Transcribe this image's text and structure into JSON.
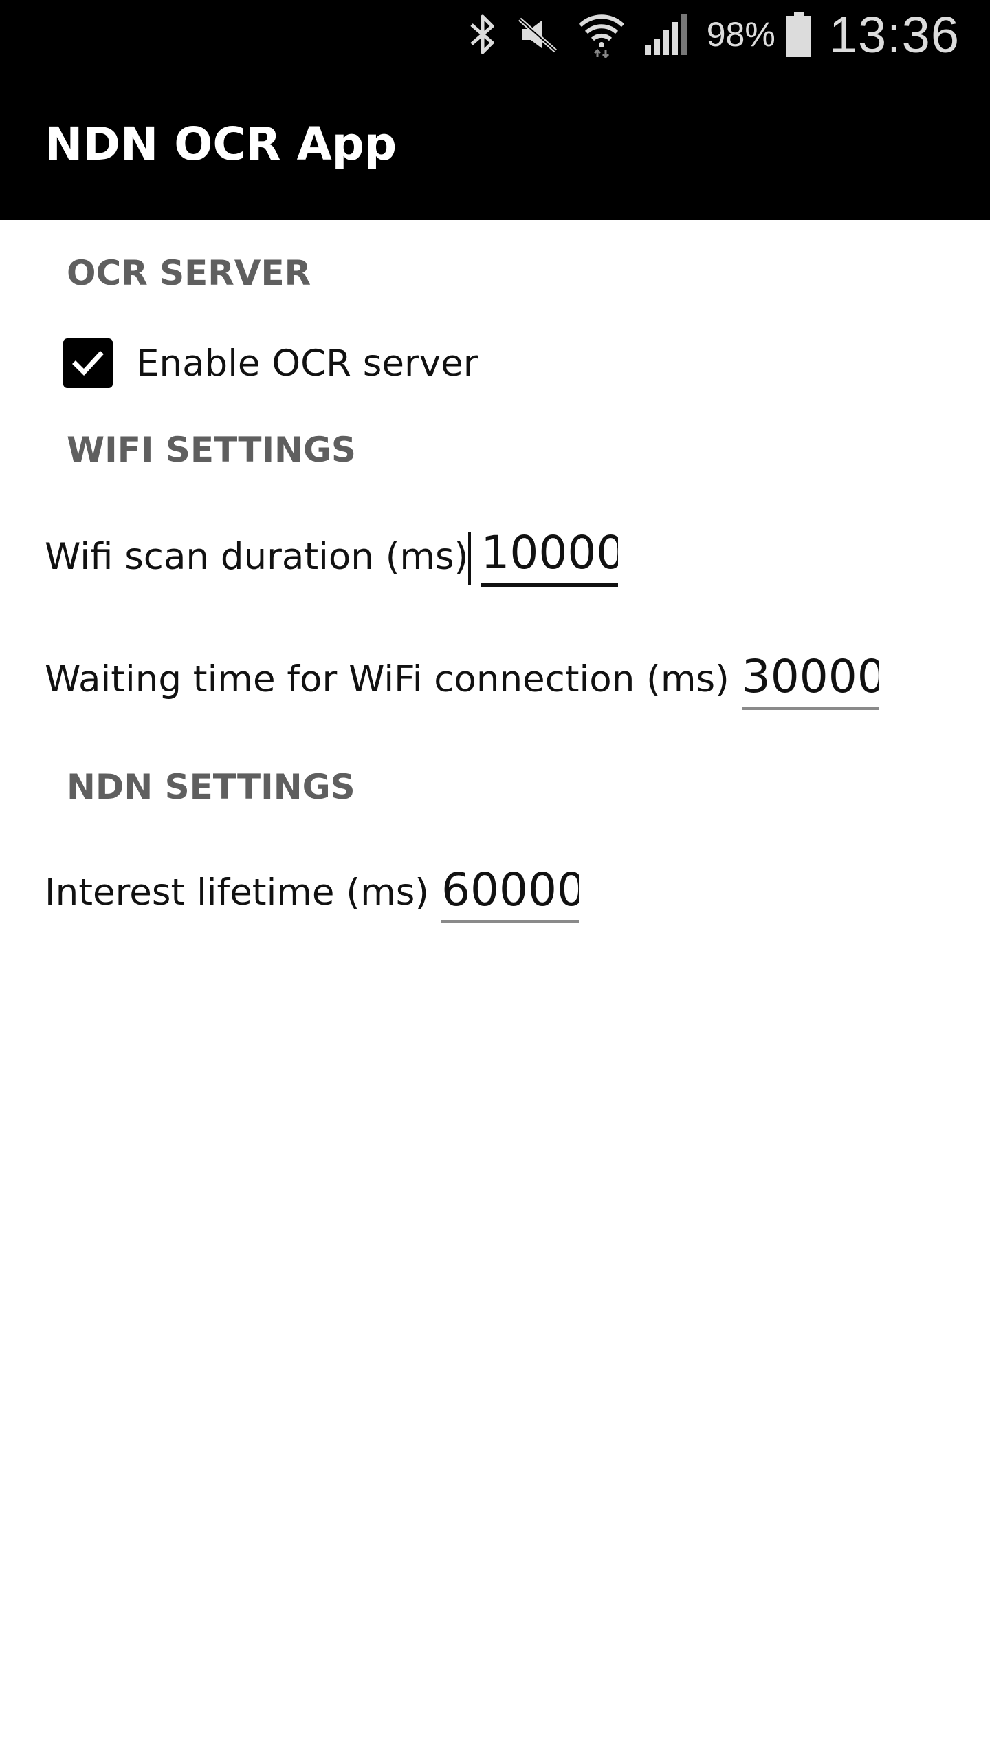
{
  "status_bar": {
    "battery_percent": "98%",
    "time": "13:36",
    "icons": [
      "bluetooth-icon",
      "mute-icon",
      "wifi-icon",
      "signal-icon",
      "battery-icon"
    ]
  },
  "app_bar": {
    "title": "NDN OCR App"
  },
  "sections": {
    "ocr_server": {
      "header": "OCR SERVER",
      "checkbox_label": "Enable OCR server",
      "checkbox_checked": true
    },
    "wifi_settings": {
      "header": "WIFI SETTINGS",
      "scan_duration_label": "Wifi scan duration (ms)",
      "scan_duration_value": "10000",
      "wait_time_label": "Waiting time for WiFi connection (ms)",
      "wait_time_value": "30000"
    },
    "ndn_settings": {
      "header": "NDN SETTINGS",
      "interest_lifetime_label": "Interest lifetime (ms)",
      "interest_lifetime_value": "60000"
    }
  },
  "colors": {
    "app_bar_bg": "#000000",
    "section_header": "#5f5f5f",
    "text": "#111111",
    "background": "#ffffff"
  }
}
